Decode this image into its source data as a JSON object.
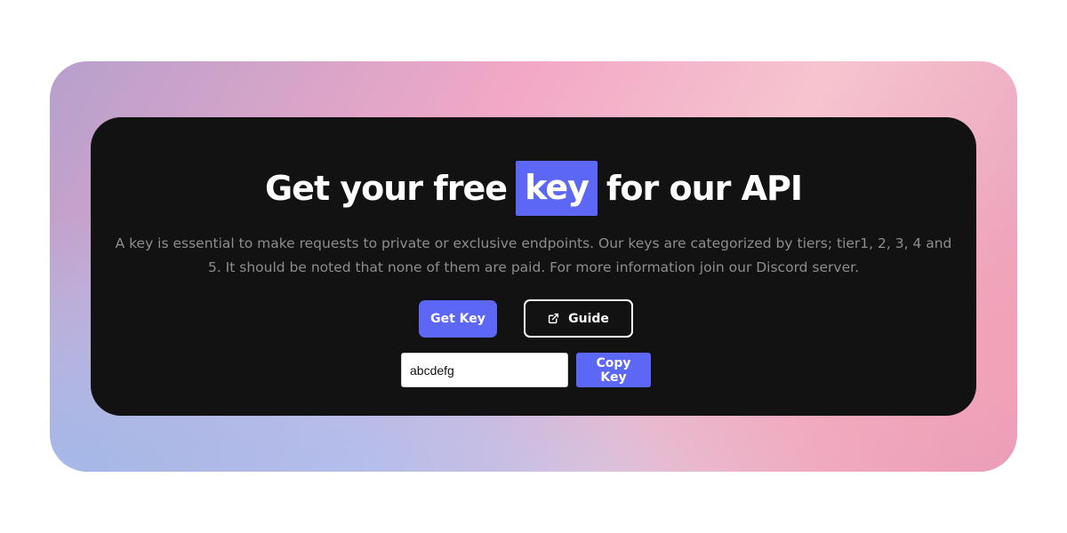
{
  "hero": {
    "title_before": "Get your free",
    "title_highlight": "key",
    "title_after": "for our API",
    "description": "A key is essential to make requests to private or exclusive endpoints. Our keys are categorized by tiers; tier1, 2, 3, 4 and 5. It should be noted that none of them are paid. For more information join our Discord server."
  },
  "actions": {
    "get_key_label": "Get Key",
    "guide_label": "Guide",
    "guide_icon": "external-link-icon"
  },
  "key_field": {
    "value": "abcdefg",
    "copy_label": "Copy Key"
  },
  "colors": {
    "accent": "#5d67f5",
    "card_background": "#121212",
    "description_text": "#8d8d8d"
  }
}
